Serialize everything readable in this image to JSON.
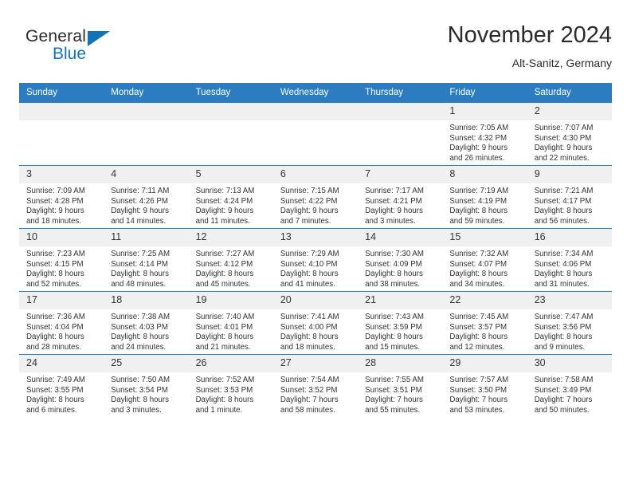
{
  "brand": {
    "name_part1": "General",
    "name_part2": "Blue",
    "triangle_color": "#1273bd"
  },
  "header": {
    "title": "November 2024",
    "subtitle": "Alt-Sanitz, Germany"
  },
  "theme": {
    "header_blue": "#2b7cc0",
    "daynum_bg": "#f0f0f0",
    "text": "#333333"
  },
  "weekdays": [
    "Sunday",
    "Monday",
    "Tuesday",
    "Wednesday",
    "Thursday",
    "Friday",
    "Saturday"
  ],
  "weeks": [
    [
      {
        "day": "",
        "empty": true
      },
      {
        "day": "",
        "empty": true
      },
      {
        "day": "",
        "empty": true
      },
      {
        "day": "",
        "empty": true
      },
      {
        "day": "",
        "empty": true
      },
      {
        "day": "1",
        "sunrise": "Sunrise: 7:05 AM",
        "sunset": "Sunset: 4:32 PM",
        "daylight": "Daylight: 9 hours and 26 minutes."
      },
      {
        "day": "2",
        "sunrise": "Sunrise: 7:07 AM",
        "sunset": "Sunset: 4:30 PM",
        "daylight": "Daylight: 9 hours and 22 minutes."
      }
    ],
    [
      {
        "day": "3",
        "sunrise": "Sunrise: 7:09 AM",
        "sunset": "Sunset: 4:28 PM",
        "daylight": "Daylight: 9 hours and 18 minutes."
      },
      {
        "day": "4",
        "sunrise": "Sunrise: 7:11 AM",
        "sunset": "Sunset: 4:26 PM",
        "daylight": "Daylight: 9 hours and 14 minutes."
      },
      {
        "day": "5",
        "sunrise": "Sunrise: 7:13 AM",
        "sunset": "Sunset: 4:24 PM",
        "daylight": "Daylight: 9 hours and 11 minutes."
      },
      {
        "day": "6",
        "sunrise": "Sunrise: 7:15 AM",
        "sunset": "Sunset: 4:22 PM",
        "daylight": "Daylight: 9 hours and 7 minutes."
      },
      {
        "day": "7",
        "sunrise": "Sunrise: 7:17 AM",
        "sunset": "Sunset: 4:21 PM",
        "daylight": "Daylight: 9 hours and 3 minutes."
      },
      {
        "day": "8",
        "sunrise": "Sunrise: 7:19 AM",
        "sunset": "Sunset: 4:19 PM",
        "daylight": "Daylight: 8 hours and 59 minutes."
      },
      {
        "day": "9",
        "sunrise": "Sunrise: 7:21 AM",
        "sunset": "Sunset: 4:17 PM",
        "daylight": "Daylight: 8 hours and 56 minutes."
      }
    ],
    [
      {
        "day": "10",
        "sunrise": "Sunrise: 7:23 AM",
        "sunset": "Sunset: 4:15 PM",
        "daylight": "Daylight: 8 hours and 52 minutes."
      },
      {
        "day": "11",
        "sunrise": "Sunrise: 7:25 AM",
        "sunset": "Sunset: 4:14 PM",
        "daylight": "Daylight: 8 hours and 48 minutes."
      },
      {
        "day": "12",
        "sunrise": "Sunrise: 7:27 AM",
        "sunset": "Sunset: 4:12 PM",
        "daylight": "Daylight: 8 hours and 45 minutes."
      },
      {
        "day": "13",
        "sunrise": "Sunrise: 7:29 AM",
        "sunset": "Sunset: 4:10 PM",
        "daylight": "Daylight: 8 hours and 41 minutes."
      },
      {
        "day": "14",
        "sunrise": "Sunrise: 7:30 AM",
        "sunset": "Sunset: 4:09 PM",
        "daylight": "Daylight: 8 hours and 38 minutes."
      },
      {
        "day": "15",
        "sunrise": "Sunrise: 7:32 AM",
        "sunset": "Sunset: 4:07 PM",
        "daylight": "Daylight: 8 hours and 34 minutes."
      },
      {
        "day": "16",
        "sunrise": "Sunrise: 7:34 AM",
        "sunset": "Sunset: 4:06 PM",
        "daylight": "Daylight: 8 hours and 31 minutes."
      }
    ],
    [
      {
        "day": "17",
        "sunrise": "Sunrise: 7:36 AM",
        "sunset": "Sunset: 4:04 PM",
        "daylight": "Daylight: 8 hours and 28 minutes."
      },
      {
        "day": "18",
        "sunrise": "Sunrise: 7:38 AM",
        "sunset": "Sunset: 4:03 PM",
        "daylight": "Daylight: 8 hours and 24 minutes."
      },
      {
        "day": "19",
        "sunrise": "Sunrise: 7:40 AM",
        "sunset": "Sunset: 4:01 PM",
        "daylight": "Daylight: 8 hours and 21 minutes."
      },
      {
        "day": "20",
        "sunrise": "Sunrise: 7:41 AM",
        "sunset": "Sunset: 4:00 PM",
        "daylight": "Daylight: 8 hours and 18 minutes."
      },
      {
        "day": "21",
        "sunrise": "Sunrise: 7:43 AM",
        "sunset": "Sunset: 3:59 PM",
        "daylight": "Daylight: 8 hours and 15 minutes."
      },
      {
        "day": "22",
        "sunrise": "Sunrise: 7:45 AM",
        "sunset": "Sunset: 3:57 PM",
        "daylight": "Daylight: 8 hours and 12 minutes."
      },
      {
        "day": "23",
        "sunrise": "Sunrise: 7:47 AM",
        "sunset": "Sunset: 3:56 PM",
        "daylight": "Daylight: 8 hours and 9 minutes."
      }
    ],
    [
      {
        "day": "24",
        "sunrise": "Sunrise: 7:49 AM",
        "sunset": "Sunset: 3:55 PM",
        "daylight": "Daylight: 8 hours and 6 minutes."
      },
      {
        "day": "25",
        "sunrise": "Sunrise: 7:50 AM",
        "sunset": "Sunset: 3:54 PM",
        "daylight": "Daylight: 8 hours and 3 minutes."
      },
      {
        "day": "26",
        "sunrise": "Sunrise: 7:52 AM",
        "sunset": "Sunset: 3:53 PM",
        "daylight": "Daylight: 8 hours and 1 minute."
      },
      {
        "day": "27",
        "sunrise": "Sunrise: 7:54 AM",
        "sunset": "Sunset: 3:52 PM",
        "daylight": "Daylight: 7 hours and 58 minutes."
      },
      {
        "day": "28",
        "sunrise": "Sunrise: 7:55 AM",
        "sunset": "Sunset: 3:51 PM",
        "daylight": "Daylight: 7 hours and 55 minutes."
      },
      {
        "day": "29",
        "sunrise": "Sunrise: 7:57 AM",
        "sunset": "Sunset: 3:50 PM",
        "daylight": "Daylight: 7 hours and 53 minutes."
      },
      {
        "day": "30",
        "sunrise": "Sunrise: 7:58 AM",
        "sunset": "Sunset: 3:49 PM",
        "daylight": "Daylight: 7 hours and 50 minutes."
      }
    ]
  ]
}
